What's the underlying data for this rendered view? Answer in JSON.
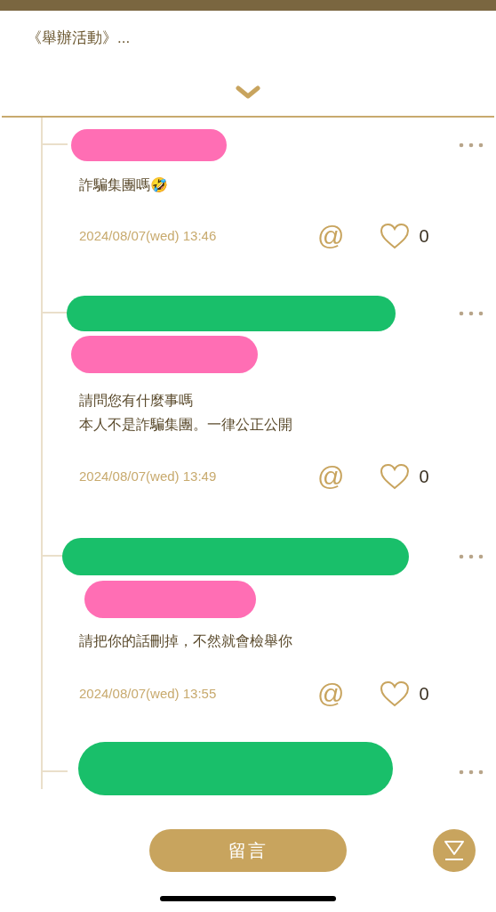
{
  "post": {
    "title": "《舉辦活動》..."
  },
  "comments": [
    {
      "redactions": [
        {
          "color": "#ff6eb4"
        }
      ],
      "lines": [
        "詐騙集團嗎🤣"
      ],
      "time": "2024/08/07(wed) 13:46",
      "mention": "@",
      "likes": "0",
      "liked": false
    },
    {
      "redactions": [
        {
          "color": "#19bf6a"
        },
        {
          "color": "#ff6eb4"
        }
      ],
      "lines": [
        "請問您有什麼事嗎",
        "本人不是詐騙集團。一律公正公開"
      ],
      "time": "2024/08/07(wed) 13:49",
      "mention": "@",
      "likes": "0",
      "liked": false
    },
    {
      "redactions": [
        {
          "color": "#19bf6a"
        },
        {
          "color": "#ff6eb4"
        }
      ],
      "lines": [
        "請把你的話刪掉，不然就會檢舉你"
      ],
      "time": "2024/08/07(wed) 13:55",
      "mention": "@",
      "likes": "0",
      "liked": false
    },
    {
      "redactions": [
        {
          "color": "#19bf6a"
        }
      ]
    }
  ],
  "comment_button": "留言"
}
